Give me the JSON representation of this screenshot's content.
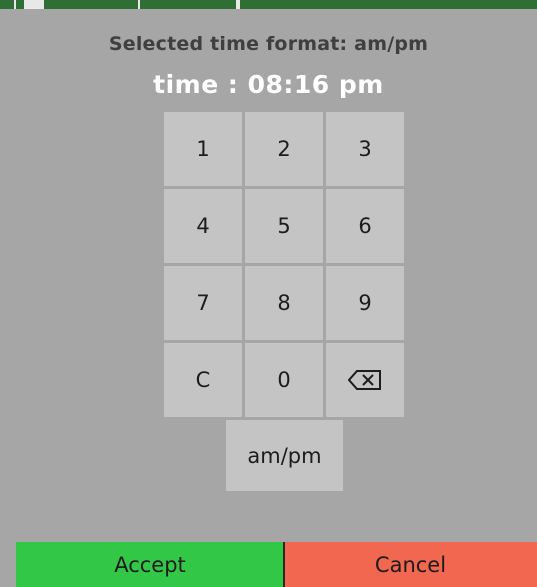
{
  "dialog": {
    "format_label": "Selected time format: am/pm",
    "time_display": "time : 08:16 pm"
  },
  "keypad": {
    "keys": [
      "1",
      "2",
      "3",
      "4",
      "5",
      "6",
      "7",
      "8",
      "9",
      "C",
      "0"
    ],
    "backspace_icon": "backspace-icon",
    "ampm_label": "am/pm"
  },
  "footer": {
    "accept_label": "Accept",
    "cancel_label": "Cancel"
  },
  "colors": {
    "background": "#a6a6a6",
    "key": "#c4c4c4",
    "accept": "#33c748",
    "cancel": "#f2674f"
  }
}
